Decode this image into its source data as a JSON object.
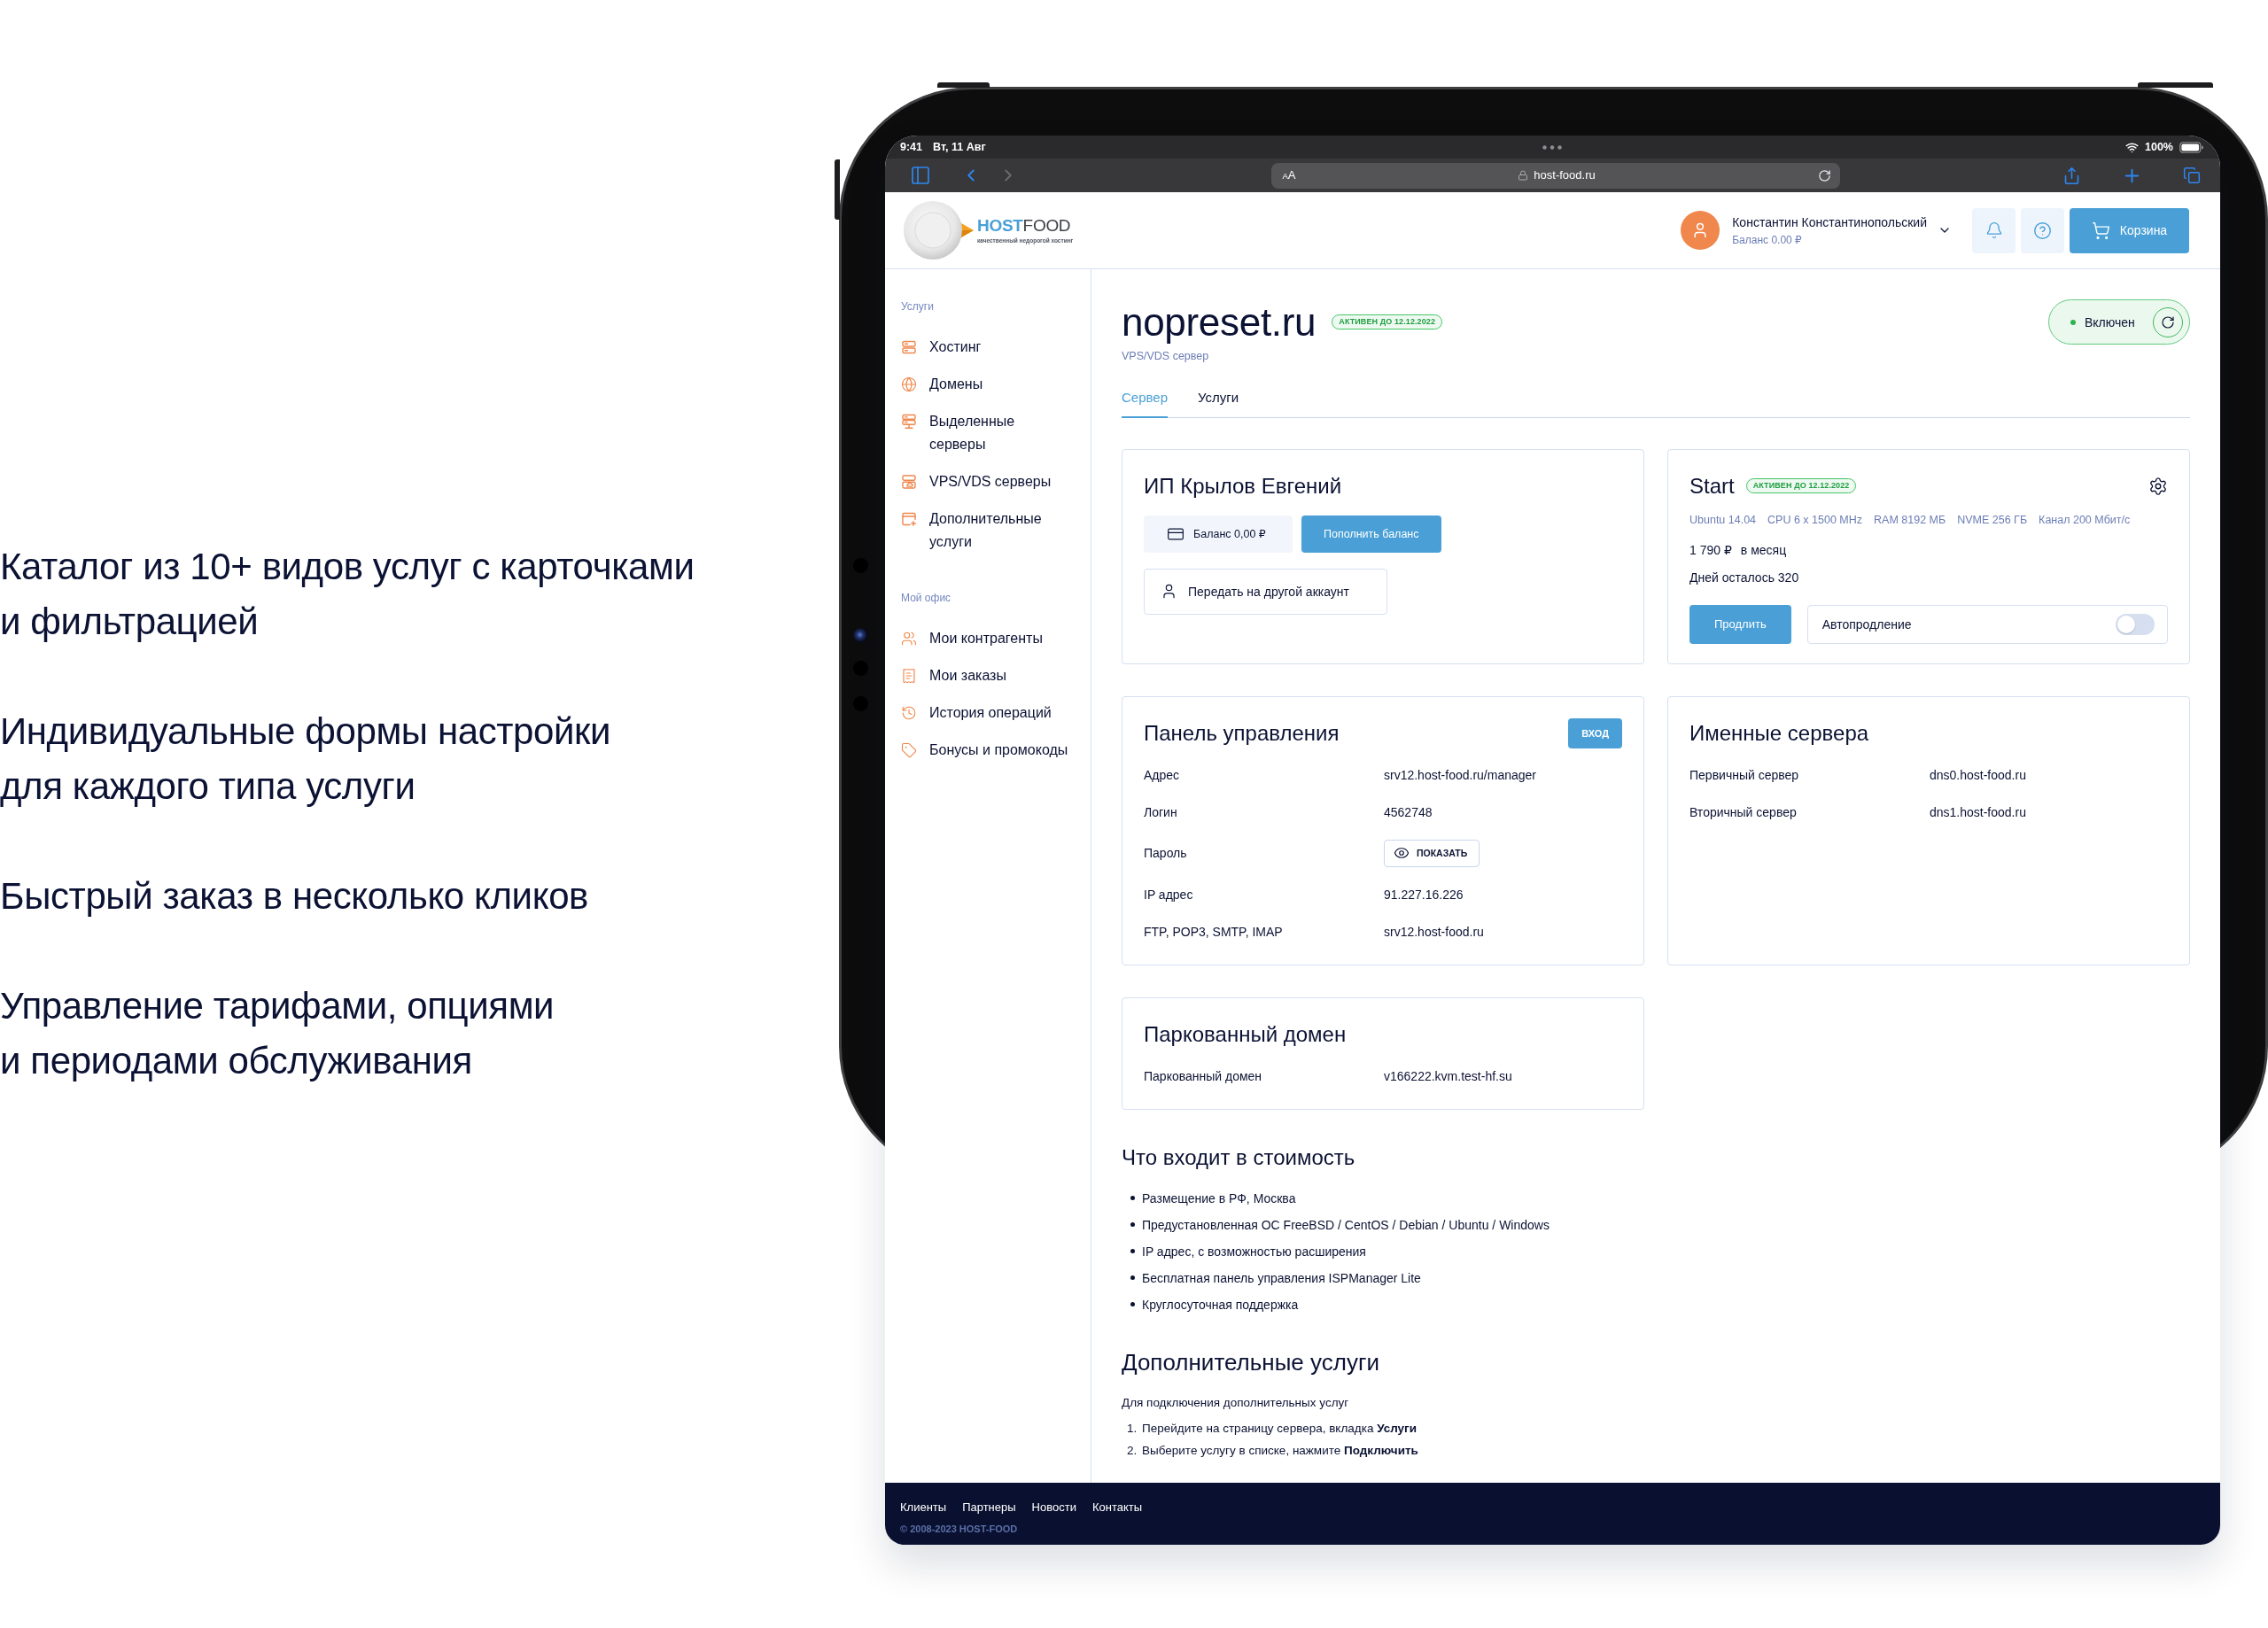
{
  "features": [
    {
      "lines": [
        "Каталог из 10+ видов услуг с карточками",
        "и фильтрацией"
      ]
    },
    {
      "lines": [
        "Индивидуальные формы настройки",
        "для каждого типа услуги"
      ]
    },
    {
      "lines": [
        "Быстрый заказ в несколько кликов"
      ]
    },
    {
      "lines": [
        "Управление тарифами, опциями",
        "и периодами обслуживания"
      ]
    }
  ],
  "status_bar": {
    "time": "9:41",
    "date": "Вт, 11 Авг",
    "battery": "100%"
  },
  "browser_toolbar": {
    "text_size": "AA",
    "url": "host-food.ru"
  },
  "header": {
    "logo": "**HOST**FOOD",
    "tagline": "качественный недорогой хостинг",
    "user_name": "Константин Константинопольский",
    "user_balance": "Баланс 0.00 ₽",
    "cart_button": "Корзина"
  },
  "sidebar": {
    "sections": [
      {
        "title": "Услуги",
        "items": [
          "Хостинг",
          "Домены",
          "Выделенные серверы",
          "VPS/VDS серверы",
          "Дополнительные услуги"
        ]
      },
      {
        "title": "Мой офис",
        "items": [
          "Мои контрагенты",
          "Мои заказы",
          "История операций",
          "Бонусы и промокоды"
        ]
      }
    ]
  },
  "service": {
    "name": "nopreset.ru",
    "badge": "АКТИВЕН ДО 12.12.2022",
    "type": "VPS/VDS сервер",
    "power": {
      "label": "Включен",
      "on": true
    }
  },
  "tabs": [
    {
      "label": "Сервер",
      "selected": true
    },
    {
      "label": "Услуги",
      "selected": false
    }
  ],
  "owner_card": {
    "title": "ИП Крылов Евгений",
    "balance": "Баланс 0,00 ₽",
    "top_up_button": "Пополнить баланс",
    "transfer_button": "Передать на другой аккаунт"
  },
  "tariff_card": {
    "title": "Start",
    "badge": "АКТИВЕН ДО 12.12.2022",
    "specs": [
      "Ubuntu 14.04",
      "CPU 6 x 1500 MHz",
      "RAM 8192 МБ",
      "NVME 256 ГБ",
      "Канал 200 Мбит/с"
    ],
    "price": "1 790 ₽",
    "period": "в месяц",
    "days_left": "Дней осталось 320",
    "renew_button": "Продлить",
    "autorenew": {
      "label": "Автопродление",
      "on": false
    }
  },
  "control_panel_card": {
    "title": "Панель управления",
    "login_button": "ВХОД",
    "rows": [
      {
        "kind": "text",
        "label": "Адрес",
        "value": "srv12.host-food.ru/manager"
      },
      {
        "kind": "text",
        "label": "Логин",
        "value": "4562748"
      },
      {
        "kind": "secret",
        "label": "Пароль",
        "button": "ПОКАЗАТЬ"
      },
      {
        "kind": "text",
        "label": "IP адрес",
        "value": "91.227.16.226"
      },
      {
        "kind": "text",
        "label": "FTP, POP3, SMTP, IMAP",
        "value": "srv12.host-food.ru"
      }
    ]
  },
  "name_servers_card": {
    "title": "Именные сервера",
    "rows": [
      {
        "label": "Первичный сервер",
        "value": "dns0.host-food.ru"
      },
      {
        "label": "Вторичный сервер",
        "value": "dns1.host-food.ru"
      }
    ]
  },
  "parked_domain_card": {
    "title": "Паркованный домен",
    "rows": [
      {
        "label": "Паркованный домен",
        "value": "v166222.kvm.test-hf.su"
      }
    ]
  },
  "included": {
    "title": "Что входит в стоимость",
    "items": [
      "Размещение в РФ, Москва",
      "Предустановленная ОС FreeBSD / CentOS / Debian / Ubuntu / Windows",
      "IP адрес, с возможностью расширения",
      "Бесплатная панель управления ISPManager Lite",
      "Круглосуточная поддержка"
    ]
  },
  "extra_services": {
    "title": "Дополнительные услуги",
    "intro": "Для подключения дополнительных услуг",
    "steps": [
      {
        "number": "1.",
        "text": "Перейдите на страницу сервера, вкладка **Услуги**"
      },
      {
        "number": "2.",
        "text": "Выберите услугу в списке, нажмите **Подключить**"
      }
    ]
  },
  "footer": {
    "links": [
      "Клиенты",
      "Партнеры",
      "Новости",
      "Контакты"
    ],
    "copyright": "© 2008-2023 HOST-FOOD"
  }
}
